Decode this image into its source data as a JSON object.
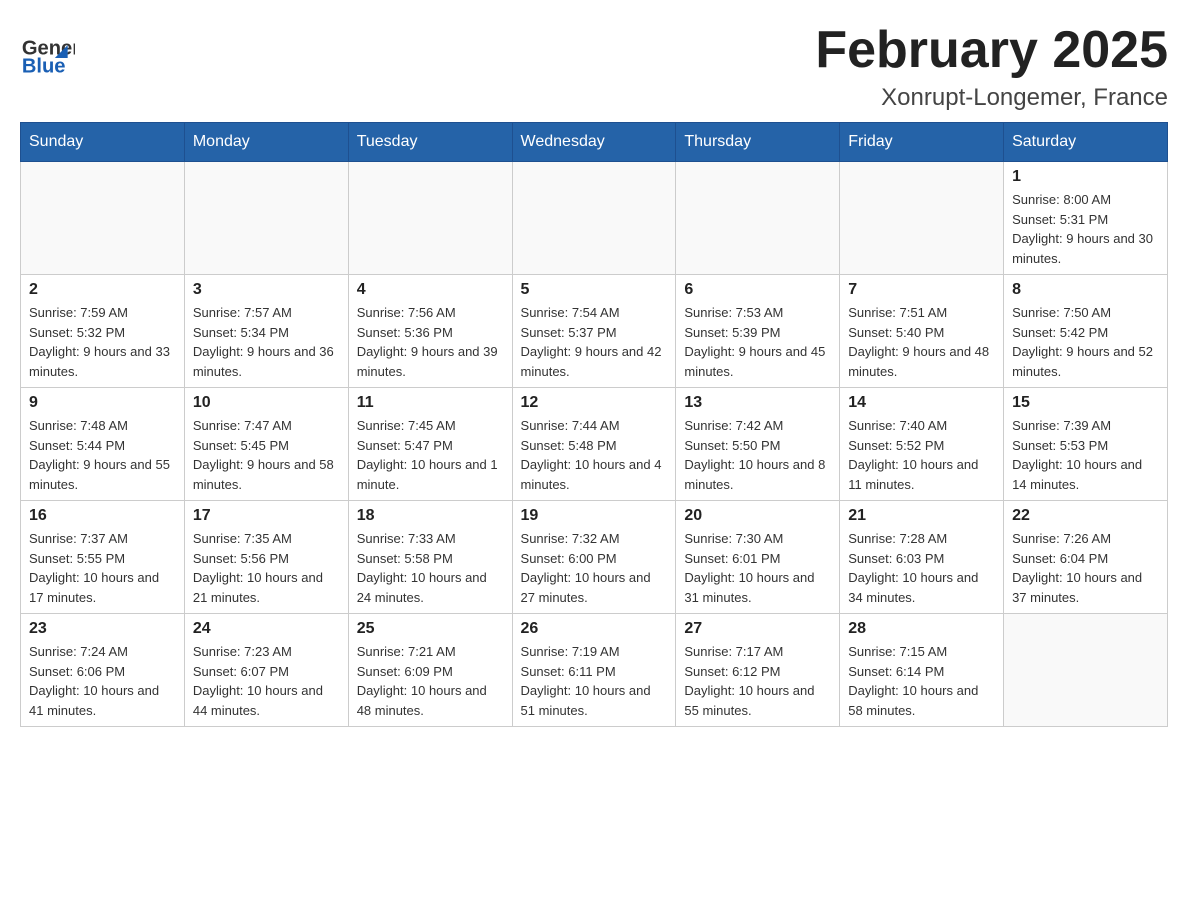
{
  "header": {
    "title": "February 2025",
    "subtitle": "Xonrupt-Longemer, France"
  },
  "days_of_week": [
    "Sunday",
    "Monday",
    "Tuesday",
    "Wednesday",
    "Thursday",
    "Friday",
    "Saturday"
  ],
  "weeks": [
    {
      "days": [
        {
          "number": "",
          "info": ""
        },
        {
          "number": "",
          "info": ""
        },
        {
          "number": "",
          "info": ""
        },
        {
          "number": "",
          "info": ""
        },
        {
          "number": "",
          "info": ""
        },
        {
          "number": "",
          "info": ""
        },
        {
          "number": "1",
          "info": "Sunrise: 8:00 AM\nSunset: 5:31 PM\nDaylight: 9 hours and 30 minutes."
        }
      ]
    },
    {
      "days": [
        {
          "number": "2",
          "info": "Sunrise: 7:59 AM\nSunset: 5:32 PM\nDaylight: 9 hours and 33 minutes."
        },
        {
          "number": "3",
          "info": "Sunrise: 7:57 AM\nSunset: 5:34 PM\nDaylight: 9 hours and 36 minutes."
        },
        {
          "number": "4",
          "info": "Sunrise: 7:56 AM\nSunset: 5:36 PM\nDaylight: 9 hours and 39 minutes."
        },
        {
          "number": "5",
          "info": "Sunrise: 7:54 AM\nSunset: 5:37 PM\nDaylight: 9 hours and 42 minutes."
        },
        {
          "number": "6",
          "info": "Sunrise: 7:53 AM\nSunset: 5:39 PM\nDaylight: 9 hours and 45 minutes."
        },
        {
          "number": "7",
          "info": "Sunrise: 7:51 AM\nSunset: 5:40 PM\nDaylight: 9 hours and 48 minutes."
        },
        {
          "number": "8",
          "info": "Sunrise: 7:50 AM\nSunset: 5:42 PM\nDaylight: 9 hours and 52 minutes."
        }
      ]
    },
    {
      "days": [
        {
          "number": "9",
          "info": "Sunrise: 7:48 AM\nSunset: 5:44 PM\nDaylight: 9 hours and 55 minutes."
        },
        {
          "number": "10",
          "info": "Sunrise: 7:47 AM\nSunset: 5:45 PM\nDaylight: 9 hours and 58 minutes."
        },
        {
          "number": "11",
          "info": "Sunrise: 7:45 AM\nSunset: 5:47 PM\nDaylight: 10 hours and 1 minute."
        },
        {
          "number": "12",
          "info": "Sunrise: 7:44 AM\nSunset: 5:48 PM\nDaylight: 10 hours and 4 minutes."
        },
        {
          "number": "13",
          "info": "Sunrise: 7:42 AM\nSunset: 5:50 PM\nDaylight: 10 hours and 8 minutes."
        },
        {
          "number": "14",
          "info": "Sunrise: 7:40 AM\nSunset: 5:52 PM\nDaylight: 10 hours and 11 minutes."
        },
        {
          "number": "15",
          "info": "Sunrise: 7:39 AM\nSunset: 5:53 PM\nDaylight: 10 hours and 14 minutes."
        }
      ]
    },
    {
      "days": [
        {
          "number": "16",
          "info": "Sunrise: 7:37 AM\nSunset: 5:55 PM\nDaylight: 10 hours and 17 minutes."
        },
        {
          "number": "17",
          "info": "Sunrise: 7:35 AM\nSunset: 5:56 PM\nDaylight: 10 hours and 21 minutes."
        },
        {
          "number": "18",
          "info": "Sunrise: 7:33 AM\nSunset: 5:58 PM\nDaylight: 10 hours and 24 minutes."
        },
        {
          "number": "19",
          "info": "Sunrise: 7:32 AM\nSunset: 6:00 PM\nDaylight: 10 hours and 27 minutes."
        },
        {
          "number": "20",
          "info": "Sunrise: 7:30 AM\nSunset: 6:01 PM\nDaylight: 10 hours and 31 minutes."
        },
        {
          "number": "21",
          "info": "Sunrise: 7:28 AM\nSunset: 6:03 PM\nDaylight: 10 hours and 34 minutes."
        },
        {
          "number": "22",
          "info": "Sunrise: 7:26 AM\nSunset: 6:04 PM\nDaylight: 10 hours and 37 minutes."
        }
      ]
    },
    {
      "days": [
        {
          "number": "23",
          "info": "Sunrise: 7:24 AM\nSunset: 6:06 PM\nDaylight: 10 hours and 41 minutes."
        },
        {
          "number": "24",
          "info": "Sunrise: 7:23 AM\nSunset: 6:07 PM\nDaylight: 10 hours and 44 minutes."
        },
        {
          "number": "25",
          "info": "Sunrise: 7:21 AM\nSunset: 6:09 PM\nDaylight: 10 hours and 48 minutes."
        },
        {
          "number": "26",
          "info": "Sunrise: 7:19 AM\nSunset: 6:11 PM\nDaylight: 10 hours and 51 minutes."
        },
        {
          "number": "27",
          "info": "Sunrise: 7:17 AM\nSunset: 6:12 PM\nDaylight: 10 hours and 55 minutes."
        },
        {
          "number": "28",
          "info": "Sunrise: 7:15 AM\nSunset: 6:14 PM\nDaylight: 10 hours and 58 minutes."
        },
        {
          "number": "",
          "info": ""
        }
      ]
    }
  ]
}
